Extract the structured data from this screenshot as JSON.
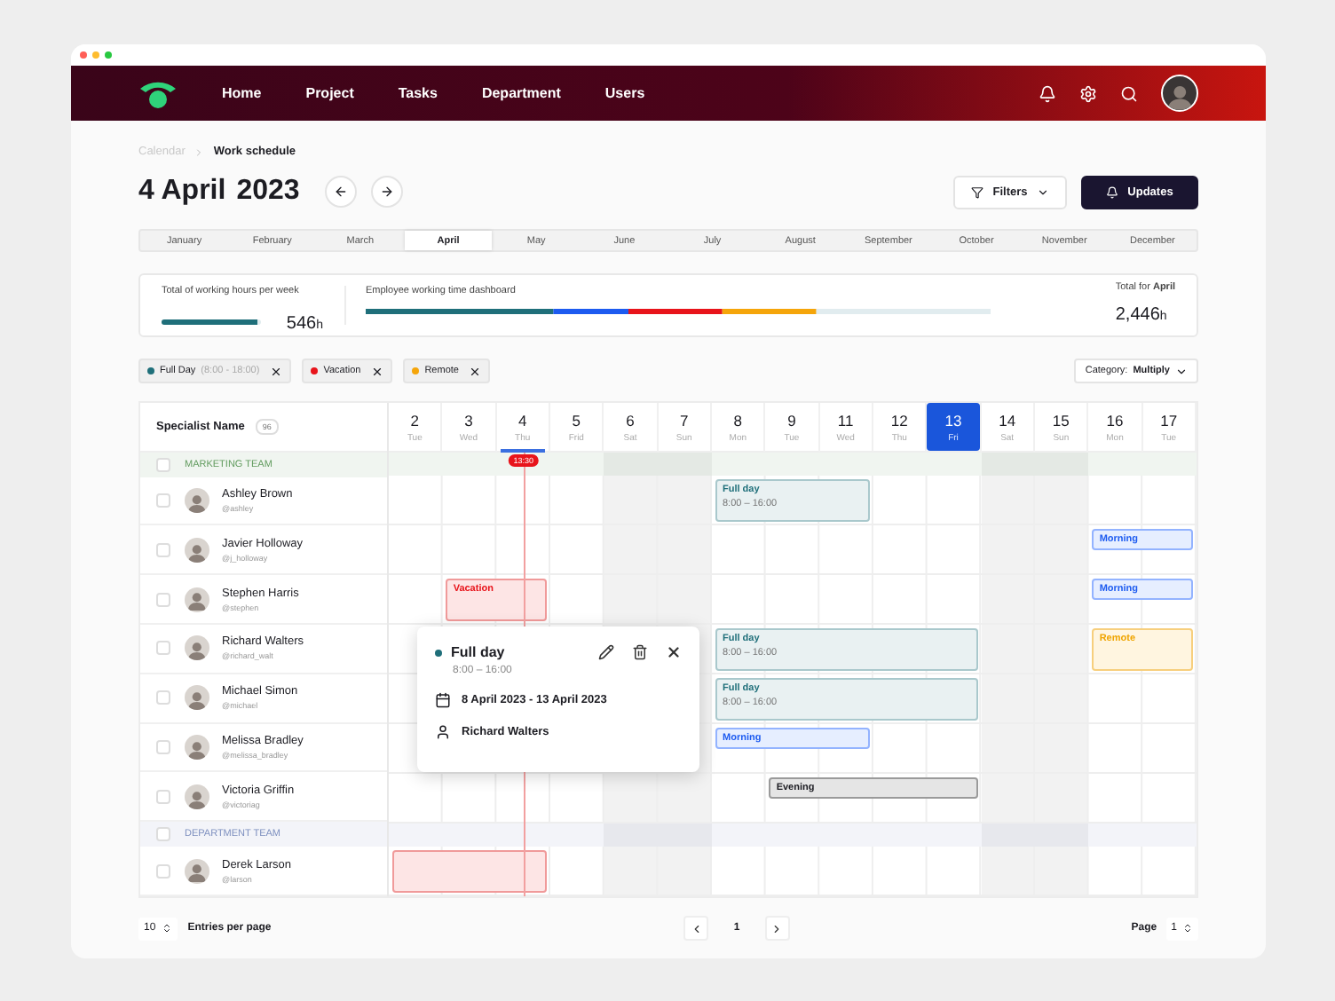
{
  "nav": {
    "items": [
      {
        "label": "Home"
      },
      {
        "label": "Project"
      },
      {
        "label": "Tasks"
      },
      {
        "label": "Department"
      },
      {
        "label": "Users"
      }
    ]
  },
  "breadcrumb": [
    {
      "label": "Calendar",
      "current": false
    },
    {
      "label": "Work schedule",
      "current": true
    }
  ],
  "title": {
    "date": "4 April",
    "year": "2023"
  },
  "actions": {
    "filters": "Filters",
    "updates": "Updates"
  },
  "months": [
    {
      "label": "January",
      "selected": false
    },
    {
      "label": "February",
      "selected": false
    },
    {
      "label": "March",
      "selected": false
    },
    {
      "label": "April",
      "selected": true
    },
    {
      "label": "May",
      "selected": false
    },
    {
      "label": "June",
      "selected": false
    },
    {
      "label": "July",
      "selected": false
    },
    {
      "label": "August",
      "selected": false
    },
    {
      "label": "September",
      "selected": false
    },
    {
      "label": "October",
      "selected": false
    },
    {
      "label": "November",
      "selected": false
    },
    {
      "label": "December",
      "selected": false
    }
  ],
  "stats": {
    "weekly": {
      "label": "Total of working hours per week",
      "value": "546",
      "unit": "h",
      "level": 0.95
    },
    "dashboard": {
      "label": "Employee working time dashboard"
    },
    "total": {
      "label": "Total for **April**",
      "value": "2,446",
      "unit": "h"
    }
  },
  "chips": [
    {
      "label": "Full Day",
      "detail": "(8:00 - 18:00)",
      "color": "#1f6f7a"
    },
    {
      "label": "Vacation",
      "color": "#e8141b"
    },
    {
      "label": "Remote",
      "color": "#f5a50a"
    }
  ],
  "category": {
    "label": "Category:",
    "value": "Multiply"
  },
  "schedule": {
    "header": "Specialist Name",
    "count": "96",
    "now": "13:30",
    "days": [
      {
        "day": "2",
        "weekday": "Tue",
        "weekend": false,
        "today": false,
        "selected": false
      },
      {
        "day": "3",
        "weekday": "Wed",
        "weekend": false,
        "today": false,
        "selected": false
      },
      {
        "day": "4",
        "weekday": "Thu",
        "weekend": false,
        "today": true,
        "selected": false
      },
      {
        "day": "5",
        "weekday": "Frid",
        "weekend": false,
        "today": false,
        "selected": false
      },
      {
        "day": "6",
        "weekday": "Sat",
        "weekend": true,
        "today": false,
        "selected": false
      },
      {
        "day": "7",
        "weekday": "Sun",
        "weekend": true,
        "today": false,
        "selected": false
      },
      {
        "day": "8",
        "weekday": "Mon",
        "weekend": false,
        "today": false,
        "selected": false
      },
      {
        "day": "9",
        "weekday": "Tue",
        "weekend": false,
        "today": false,
        "selected": false
      },
      {
        "day": "11",
        "weekday": "Wed",
        "weekend": false,
        "today": false,
        "selected": false
      },
      {
        "day": "12",
        "weekday": "Thu",
        "weekend": false,
        "today": false,
        "selected": false
      },
      {
        "day": "13",
        "weekday": "Fri",
        "weekend": false,
        "today": false,
        "selected": true
      },
      {
        "day": "14",
        "weekday": "Sat",
        "weekend": true,
        "today": false,
        "selected": false
      },
      {
        "day": "15",
        "weekday": "Sun",
        "weekend": true,
        "today": false,
        "selected": false
      },
      {
        "day": "16",
        "weekday": "Mon",
        "weekend": false,
        "today": false,
        "selected": false
      },
      {
        "day": "17",
        "weekday": "Tue",
        "weekend": false,
        "today": false,
        "selected": false
      }
    ],
    "rows": [
      {
        "kind": "team",
        "label": "MARKETING TEAM",
        "color": "#5f9a5c",
        "checked": false
      },
      {
        "kind": "person",
        "name": "Ashley Brown",
        "handle": "@ashley",
        "checked": false,
        "cells": [
          {
            "kind": "empty"
          },
          {
            "kind": "empty"
          },
          {
            "kind": "empty"
          },
          {
            "kind": "empty"
          },
          {
            "kind": "empty"
          },
          {
            "kind": "empty"
          },
          {
            "kind": "fullday",
            "title": "Full day",
            "time": "8:00 – 16:00"
          },
          {
            "kind": "cont"
          },
          {
            "kind": "cont"
          },
          {
            "kind": "empty"
          },
          {
            "kind": "empty"
          },
          {
            "kind": "empty"
          },
          {
            "kind": "empty"
          },
          {
            "kind": "empty"
          },
          {
            "kind": "empty"
          }
        ]
      },
      {
        "kind": "person",
        "name": "Javier Holloway",
        "handle": "@j_holloway",
        "checked": false,
        "cells": [
          {
            "kind": "empty"
          },
          {
            "kind": "empty"
          },
          {
            "kind": "empty"
          },
          {
            "kind": "empty"
          },
          {
            "kind": "empty"
          },
          {
            "kind": "empty"
          },
          {
            "kind": "empty"
          },
          {
            "kind": "empty"
          },
          {
            "kind": "empty"
          },
          {
            "kind": "empty"
          },
          {
            "kind": "empty"
          },
          {
            "kind": "empty"
          },
          {
            "kind": "empty"
          },
          {
            "kind": "morning",
            "title": "Morning"
          },
          {
            "kind": "cont"
          }
        ]
      },
      {
        "kind": "person",
        "name": "Stephen Harris",
        "handle": "@stephen",
        "checked": false,
        "cells": [
          {
            "kind": "empty"
          },
          {
            "kind": "vacation",
            "title": "Vacation"
          },
          {
            "kind": "cont"
          },
          {
            "kind": "empty"
          },
          {
            "kind": "empty"
          },
          {
            "kind": "empty"
          },
          {
            "kind": "empty"
          },
          {
            "kind": "empty"
          },
          {
            "kind": "empty"
          },
          {
            "kind": "empty"
          },
          {
            "kind": "empty"
          },
          {
            "kind": "empty"
          },
          {
            "kind": "empty"
          },
          {
            "kind": "morning",
            "title": "Morning"
          },
          {
            "kind": "cont"
          }
        ]
      },
      {
        "kind": "person",
        "name": "Richard Walters",
        "handle": "@richard_walt",
        "checked": false,
        "cells": [
          {
            "kind": "empty"
          },
          {
            "kind": "empty"
          },
          {
            "kind": "empty"
          },
          {
            "kind": "empty"
          },
          {
            "kind": "empty"
          },
          {
            "kind": "empty"
          },
          {
            "kind": "fullday",
            "title": "Full day",
            "time": "8:00 – 16:00"
          },
          {
            "kind": "cont"
          },
          {
            "kind": "cont"
          },
          {
            "kind": "cont"
          },
          {
            "kind": "cont"
          },
          {
            "kind": "empty"
          },
          {
            "kind": "empty"
          },
          {
            "kind": "remote",
            "title": "Remote"
          },
          {
            "kind": "cont"
          }
        ]
      },
      {
        "kind": "person",
        "name": "Michael Simon",
        "handle": "@michael",
        "checked": false,
        "cells": [
          {
            "kind": "empty"
          },
          {
            "kind": "empty"
          },
          {
            "kind": "empty"
          },
          {
            "kind": "empty"
          },
          {
            "kind": "empty"
          },
          {
            "kind": "empty"
          },
          {
            "kind": "fullday",
            "title": "Full day",
            "time": "8:00 – 16:00"
          },
          {
            "kind": "cont"
          },
          {
            "kind": "cont"
          },
          {
            "kind": "cont"
          },
          {
            "kind": "cont"
          },
          {
            "kind": "empty"
          },
          {
            "kind": "empty"
          },
          {
            "kind": "empty"
          },
          {
            "kind": "empty"
          }
        ]
      },
      {
        "kind": "person",
        "name": "Melissa Bradley",
        "handle": "@melissa_bradley",
        "checked": false,
        "cells": [
          {
            "kind": "empty"
          },
          {
            "kind": "empty"
          },
          {
            "kind": "empty"
          },
          {
            "kind": "empty"
          },
          {
            "kind": "empty"
          },
          {
            "kind": "empty"
          },
          {
            "kind": "morning",
            "title": "Morning"
          },
          {
            "kind": "cont"
          },
          {
            "kind": "cont"
          },
          {
            "kind": "empty"
          },
          {
            "kind": "empty"
          },
          {
            "kind": "empty"
          },
          {
            "kind": "empty"
          },
          {
            "kind": "empty"
          },
          {
            "kind": "empty"
          }
        ]
      },
      {
        "kind": "person",
        "name": "Victoria Griffin",
        "handle": "@victoriag",
        "checked": false,
        "cells": [
          {
            "kind": "empty"
          },
          {
            "kind": "empty"
          },
          {
            "kind": "empty"
          },
          {
            "kind": "empty"
          },
          {
            "kind": "empty"
          },
          {
            "kind": "empty"
          },
          {
            "kind": "empty"
          },
          {
            "kind": "evening",
            "title": "Evening"
          },
          {
            "kind": "cont"
          },
          {
            "kind": "cont"
          },
          {
            "kind": "cont"
          },
          {
            "kind": "empty"
          },
          {
            "kind": "empty"
          },
          {
            "kind": "empty"
          },
          {
            "kind": "empty"
          }
        ]
      },
      {
        "kind": "team",
        "label": "DEPARTMENT TEAM",
        "color": "#7d8fbf",
        "checked": false
      },
      {
        "kind": "person",
        "name": "Derek Larson",
        "handle": "@larson",
        "checked": false,
        "cells": [
          {
            "kind": "vacation"
          },
          {
            "kind": "cont"
          },
          {
            "kind": "cont"
          },
          {
            "kind": "empty"
          },
          {
            "kind": "empty"
          },
          {
            "kind": "empty"
          },
          {
            "kind": "empty"
          },
          {
            "kind": "empty"
          },
          {
            "kind": "empty"
          },
          {
            "kind": "empty"
          },
          {
            "kind": "empty"
          },
          {
            "kind": "empty"
          },
          {
            "kind": "empty"
          },
          {
            "kind": "empty"
          },
          {
            "kind": "empty"
          }
        ]
      }
    ]
  },
  "popup": {
    "title": "Full day",
    "color": "#1f6f7a",
    "time": "8:00 – 16:00",
    "dates": "8 April 2023 - 13 April 2023",
    "person": "Richard Walters"
  },
  "footer": {
    "entries": "10",
    "entries_label": "Entries per page",
    "page": "1",
    "page_label": "Page",
    "page_value": "1"
  }
}
